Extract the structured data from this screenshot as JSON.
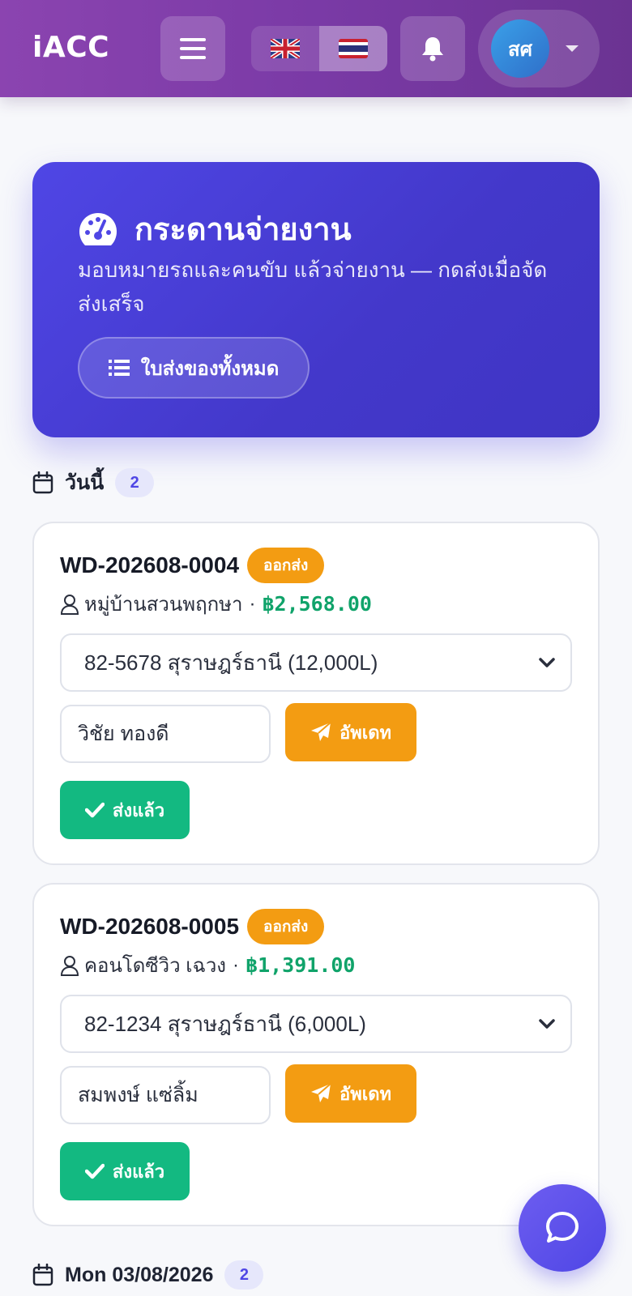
{
  "app": {
    "brand": "iACC"
  },
  "header": {
    "languages": [
      {
        "code": "en",
        "icon": "uk-flag-icon",
        "active": false
      },
      {
        "code": "th",
        "icon": "thai-flag-icon",
        "active": true
      }
    ],
    "user_initials": "สศ"
  },
  "hero": {
    "title": "กระดานจ่ายงาน",
    "subtitle": "มอบหมายรถและคนขับ แล้วจ่ายงาน — กดส่งเมื่อจัดส่งเสร็จ",
    "button_label": "ใบส่งของทั้งหมด"
  },
  "sections": [
    {
      "title": "วันนี้",
      "count": "2",
      "orders": [
        {
          "order_no": "WD-202608-0004",
          "status": "ออกส่ง",
          "customer": "หมู่บ้านสวนพฤกษา",
          "amount": "฿2,568.00",
          "vehicle": "82-5678 สุราษฎร์ธานี (12,000L)",
          "driver": "วิชัย ทองดี",
          "update_label": "อัพเดท",
          "delivered_label": "ส่งแล้ว"
        },
        {
          "order_no": "WD-202608-0005",
          "status": "ออกส่ง",
          "customer": "คอนโดซีวิว เฉวง",
          "amount": "฿1,391.00",
          "vehicle": "82-1234 สุราษฎร์ธานี (6,000L)",
          "driver": "สมพงษ์ แซ่ลิ้ม",
          "update_label": "อัพเดท",
          "delivered_label": "ส่งแล้ว"
        }
      ]
    },
    {
      "title": "Mon 03/08/2026",
      "count": "2"
    }
  ],
  "colors": {
    "topbar": "#7a3aa6",
    "hero": "#4f46e5",
    "status_out": "#f39c12",
    "update": "#f39c12",
    "delivered": "#13b981",
    "amount": "#10a36a"
  }
}
